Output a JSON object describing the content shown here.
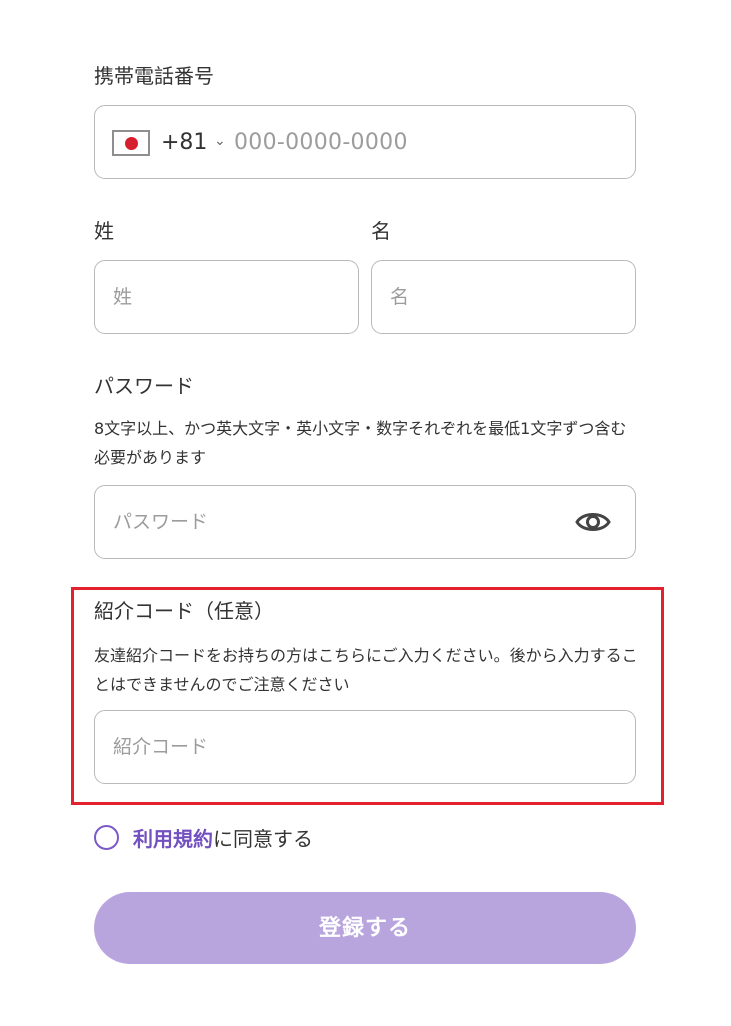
{
  "phone": {
    "label": "携帯電話番号",
    "dial_code": "+81",
    "placeholder": "000-0000-0000",
    "flag": "japan-flag-icon"
  },
  "name": {
    "last_label": "姓",
    "first_label": "名",
    "last_placeholder": "姓",
    "first_placeholder": "名"
  },
  "password": {
    "label": "パスワード",
    "help": "8文字以上、かつ英大文字・英小文字・数字それぞれを最低1文字ずつ含む必要があります",
    "placeholder": "パスワード",
    "visibility_icon": "eye-icon"
  },
  "referral": {
    "label": "紹介コード（任意）",
    "help": "友達紹介コードをお持ちの方はこちらにご入力ください。後から入力することはできませんのでご注意ください",
    "placeholder": "紹介コード",
    "highlight_color": "#e3222d"
  },
  "terms": {
    "link_label": "利用規約",
    "text": "に同意する",
    "checked": false
  },
  "submit": {
    "label": "登録する",
    "color": "#b9a5de"
  }
}
